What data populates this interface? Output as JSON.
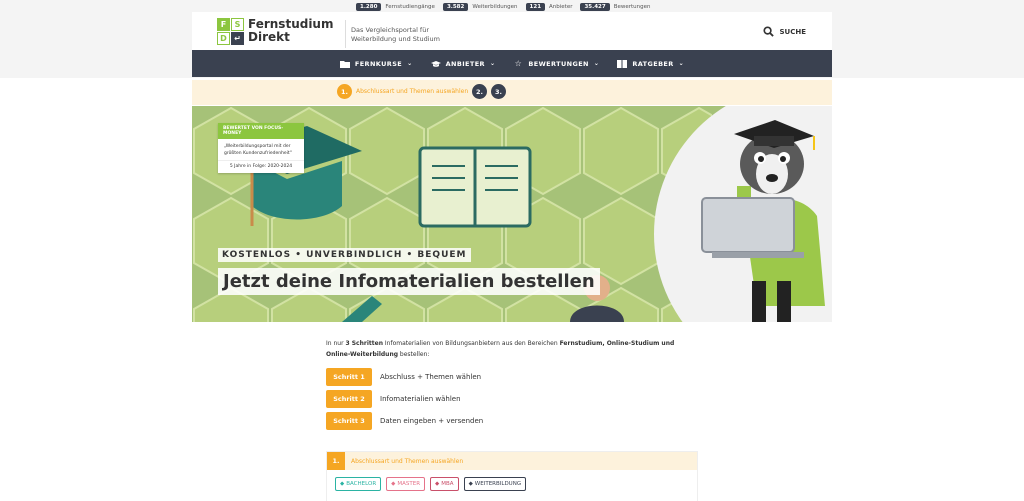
{
  "stats": [
    {
      "value": "1.280",
      "label": "Fernstudiengänge"
    },
    {
      "value": "3.582",
      "label": "Weiterbildungen"
    },
    {
      "value": "121",
      "label": "Anbieter"
    },
    {
      "value": "35.427",
      "label": "Bewertungen"
    }
  ],
  "header": {
    "logo_letters": [
      "F",
      "S",
      "D",
      "↵"
    ],
    "brand_line1": "Fernstudium",
    "brand_line2": "Direkt",
    "tagline_line1": "Das Vergleichsportal für",
    "tagline_line2": "Weiterbildung und Studium",
    "search_label": "SUCHE",
    "search_icon": "search-icon"
  },
  "nav": [
    {
      "label": "FERNKURSE",
      "icon": "folder-icon"
    },
    {
      "label": "ANBIETER",
      "icon": "graduation-cap-icon"
    },
    {
      "label": "BEWERTUNGEN",
      "icon": "star-icon"
    },
    {
      "label": "RATGEBER",
      "icon": "book-icon"
    }
  ],
  "steps": {
    "active_num": "1.",
    "active_label": "Abschlussart und Themen auswählen",
    "step2": "2.",
    "step3": "3."
  },
  "hero": {
    "award_head": "BEWERTET VON FOCUS-MONEY",
    "award_quote": "„Weiterbildungsportal mit der größten Kundenzufriedenheit\"",
    "award_sub": "5 Jahre in Folge: 2020-2024",
    "tagline": "KOSTENLOS • UNVERBINDLICH • BEQUEM",
    "title": "Jetzt deine Infomaterialien bestellen"
  },
  "intro": {
    "p1": "In nur ",
    "b1": "3 Schritten",
    "p2": " Infomaterialien von Bildungsanbietern aus den Bereichen ",
    "b2": "Fernstudium, Online-Studium und Online-Weiterbildung",
    "p3": " bestellen:"
  },
  "schritte": [
    {
      "button": "Schritt 1",
      "label": "Abschluss + Themen wählen"
    },
    {
      "button": "Schritt 2",
      "label": "Infomaterialien wählen"
    },
    {
      "button": "Schritt 3",
      "label": "Daten eingeben + versenden"
    }
  ],
  "panel": {
    "num": "1.",
    "title": "Abschlussart und Themen auswählen",
    "chips": [
      {
        "label": "BACHELOR",
        "color": "#2bb3a3"
      },
      {
        "label": "MASTER",
        "color": "#e5738a"
      },
      {
        "label": "MBA",
        "color": "#c9506a"
      },
      {
        "label": "WEITERBILDUNG",
        "color": "#3a4150"
      }
    ]
  },
  "colors": {
    "accent": "#f5a623",
    "nav": "#3a4150",
    "green": "#8cc63f"
  }
}
